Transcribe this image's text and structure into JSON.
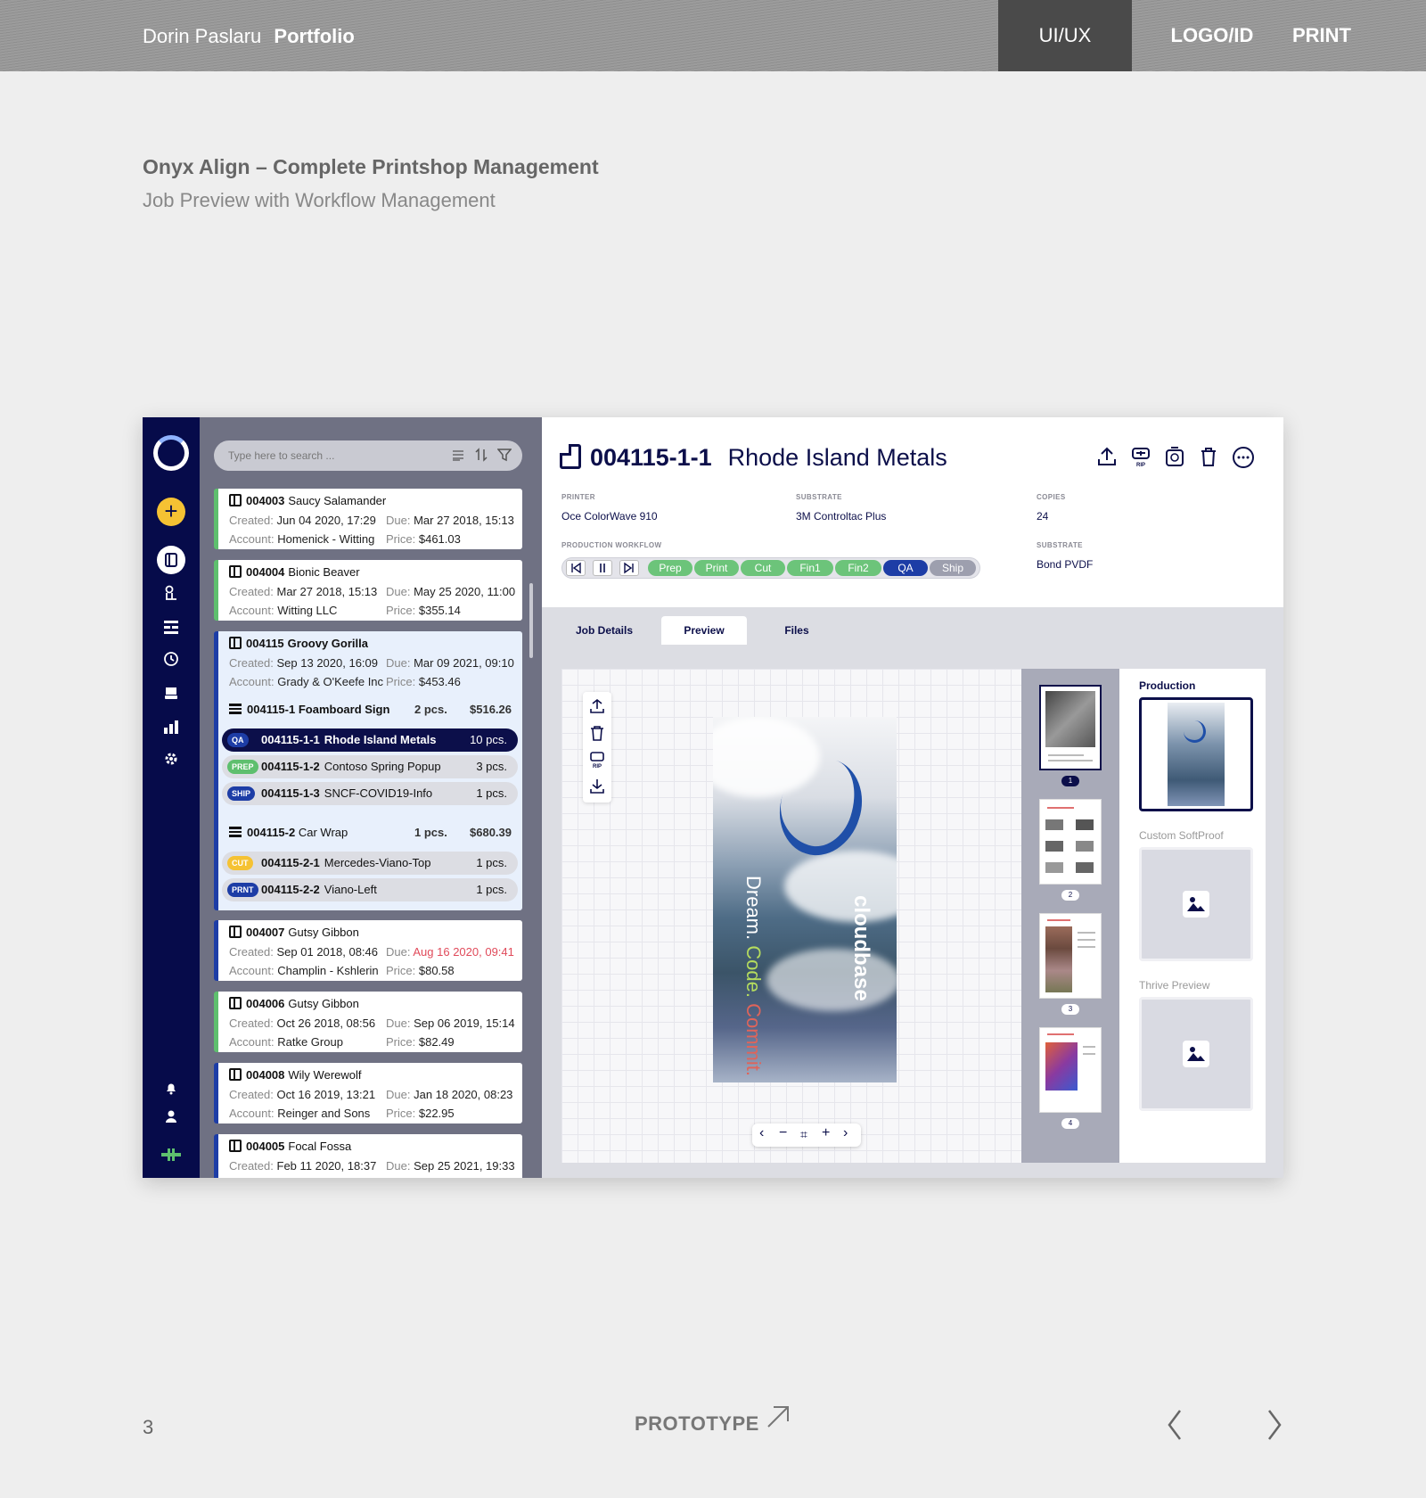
{
  "site": {
    "name": "Dorin Paslaru",
    "section": "Portfolio",
    "nav": [
      "UI/UX",
      "LOGO/ID",
      "PRINT"
    ],
    "active_nav": "UI/UX"
  },
  "project": {
    "title": "Onyx Align – Complete Printshop Management",
    "subtitle": "Job Preview with Workflow Management"
  },
  "app": {
    "search_placeholder": "Type here to search ...",
    "jobs": [
      {
        "id": "004003",
        "name": "Saucy Salamander",
        "created": "Jun 04 2020, 17:29",
        "due": "Mar 27 2018, 15:13",
        "account": "Homenick - Witting",
        "price": "$461.03"
      },
      {
        "id": "004004",
        "name": "Bionic Beaver",
        "created": "Mar 27 2018, 15:13",
        "due": "May 25 2020, 11:00",
        "account": "Witting LLC",
        "price": "$355.14"
      },
      {
        "id": "004115",
        "name": "Groovy Gorilla",
        "created": "Sep 13 2020, 16:09",
        "due": "Mar 09 2021, 09:10",
        "account": "Grady & O'Keefe Inc",
        "price": "$453.46"
      },
      {
        "id": "004007",
        "name": "Gutsy Gibbon",
        "created": "Sep 01 2018, 08:46",
        "due": "Aug 16 2020, 09:41",
        "account": "Champlin - Kshlerin",
        "price": "$80.58"
      },
      {
        "id": "004006",
        "name": "Gutsy Gibbon",
        "created": "Oct 26 2018, 08:56",
        "due": "Sep 06 2019, 15:14",
        "account": "Ratke Group",
        "price": "$82.49"
      },
      {
        "id": "004008",
        "name": "Wily Werewolf",
        "created": "Oct 16 2019, 13:21",
        "due": "Jan 18 2020, 08:23",
        "account": "Reinger and Sons",
        "price": "$22.95"
      },
      {
        "id": "004005",
        "name": "Focal Fossa",
        "created": "Feb 11 2020, 18:37",
        "due": "Sep 25 2021, 19:33"
      }
    ],
    "labels": {
      "created": "Created:",
      "due": "Due:",
      "account": "Account:",
      "price": "Price:"
    },
    "subjobs": [
      {
        "id": "004115-1",
        "name": "Foamboard Sign",
        "qty": "2 pcs.",
        "price": "$516.26",
        "items": [
          {
            "tag": "QA",
            "tag_color": "#1d3da6",
            "id": "004115-1-1",
            "name": "Rhode Island Metals",
            "qty": "10 pcs."
          },
          {
            "tag": "PREP",
            "tag_color": "#5ebf6e",
            "id": "004115-1-2",
            "name": "Contoso Spring Popup",
            "qty": "3 pcs."
          },
          {
            "tag": "SHIP",
            "tag_color": "#1d3da6",
            "id": "004115-1-3",
            "name": "SNCF-COVID19-Info",
            "qty": "1 pcs."
          }
        ]
      },
      {
        "id": "004115-2",
        "name": "Car Wrap",
        "qty": "1 pcs.",
        "price": "$680.39",
        "items": [
          {
            "tag": "CUT",
            "tag_color": "#f5c233",
            "id": "004115-2-1",
            "name": "Mercedes-Viano-Top",
            "qty": "1 pcs."
          },
          {
            "tag": "PRNT",
            "tag_color": "#1d3da6",
            "id": "004115-2-2",
            "name": "Viano-Left",
            "qty": "1 pcs."
          }
        ]
      }
    ],
    "detail": {
      "id": "004115-1-1",
      "name": "Rhode Island Metals",
      "printer_label": "PRINTER",
      "printer": "Oce ColorWave 910",
      "substrate_label": "SUBSTRATE",
      "substrate": "3M Controltac Plus",
      "copies_label": "COPIES",
      "copies": "24",
      "substrate2_label": "SUBSTRATE",
      "substrate2": "Bond PVDF",
      "workflow_label": "PRODUCTION WORKFLOW",
      "workflow": [
        {
          "label": "Prep",
          "color": "#6cc47a"
        },
        {
          "label": "Print",
          "color": "#6cc47a"
        },
        {
          "label": "Cut",
          "color": "#6cc47a"
        },
        {
          "label": "Fin1",
          "color": "#6cc47a"
        },
        {
          "label": "Fin2",
          "color": "#6cc47a"
        },
        {
          "label": "QA",
          "color": "#1d3da6"
        },
        {
          "label": "Ship",
          "color": "#9d9fae"
        }
      ],
      "tabs": [
        "Job Details",
        "Preview",
        "Files"
      ],
      "active_tab": "Preview",
      "poster_text": [
        "Dream.",
        "Code.",
        "Commit."
      ],
      "poster_brand": "cloudbase",
      "pages": [
        "1",
        "2",
        "3",
        "4"
      ],
      "proof_labels": [
        "Production",
        "Custom SoftProof",
        "Thrive Preview"
      ]
    }
  },
  "footer": {
    "page": "3",
    "link": "PROTOTYPE"
  }
}
